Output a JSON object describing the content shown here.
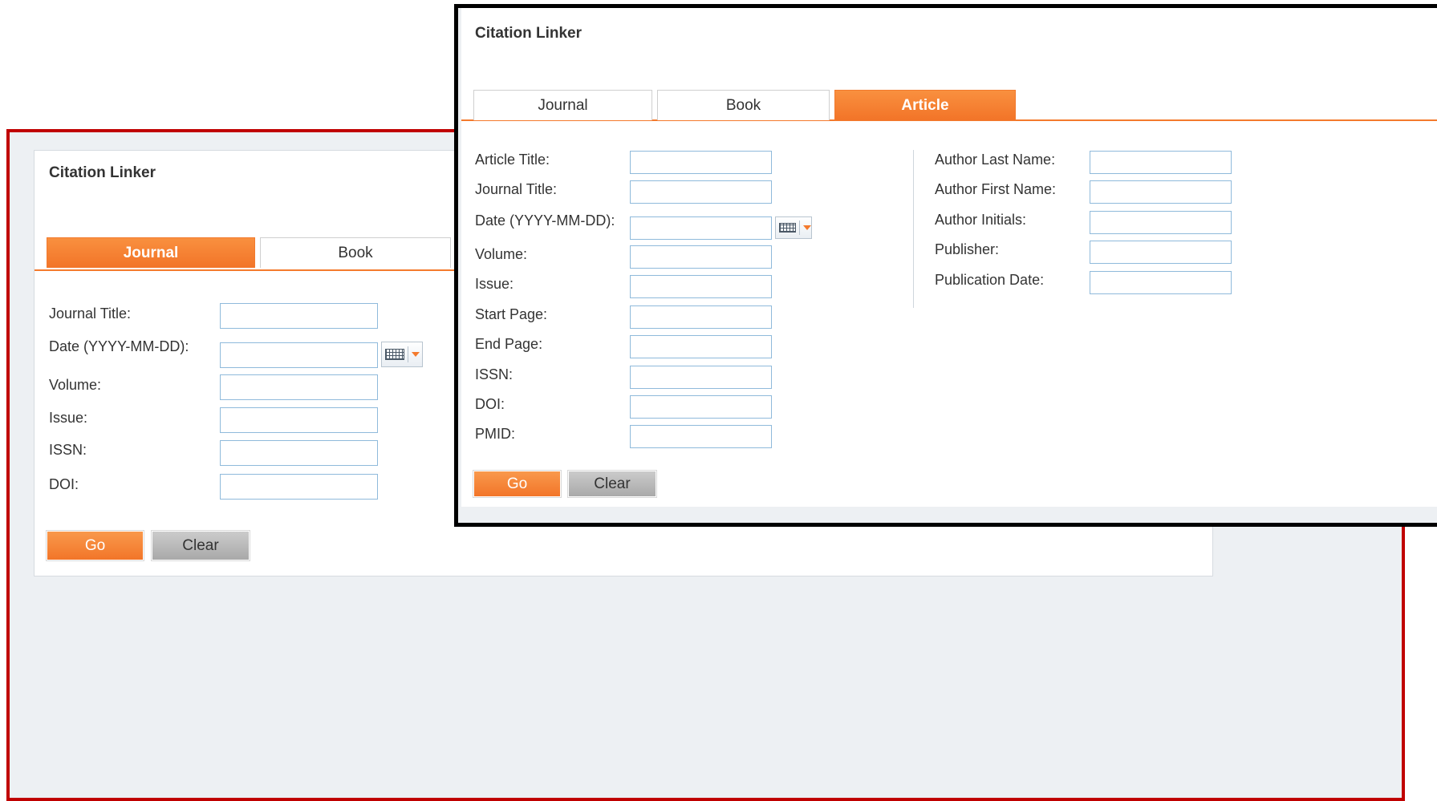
{
  "back": {
    "title": "Citation Linker",
    "tabs": [
      "Journal",
      "Book"
    ],
    "active_tab": "Journal",
    "fields": [
      {
        "label": "Journal Title:",
        "value": ""
      },
      {
        "label": "Date (YYYY-MM-DD):",
        "value": ""
      },
      {
        "label": "Volume:",
        "value": ""
      },
      {
        "label": "Issue:",
        "value": ""
      },
      {
        "label": "ISSN:",
        "value": ""
      },
      {
        "label": "DOI:",
        "value": ""
      }
    ],
    "go_label": "Go",
    "clear_label": "Clear"
  },
  "front": {
    "title": "Citation Linker",
    "tabs": [
      "Journal",
      "Book",
      "Article"
    ],
    "active_tab": "Article",
    "left_fields": [
      {
        "label": "Article Title:",
        "value": ""
      },
      {
        "label": "Journal Title:",
        "value": ""
      },
      {
        "label": "Date (YYYY-MM-DD):",
        "value": ""
      },
      {
        "label": "Volume:",
        "value": ""
      },
      {
        "label": "Issue:",
        "value": ""
      },
      {
        "label": "Start Page:",
        "value": ""
      },
      {
        "label": "End Page:",
        "value": ""
      },
      {
        "label": "ISSN:",
        "value": ""
      },
      {
        "label": "DOI:",
        "value": ""
      },
      {
        "label": "PMID:",
        "value": ""
      }
    ],
    "right_fields": [
      {
        "label": "Author Last Name:",
        "value": ""
      },
      {
        "label": "Author First Name:",
        "value": ""
      },
      {
        "label": "Author Initials:",
        "value": ""
      },
      {
        "label": "Publisher:",
        "value": ""
      },
      {
        "label": "Publication Date:",
        "value": ""
      }
    ],
    "go_label": "Go",
    "clear_label": "Clear"
  },
  "icons": {
    "calendar": "calendar-icon",
    "dropdown": "chevron-down-icon"
  },
  "colors": {
    "accent": "#f47a2d",
    "back_frame_border": "#c00000",
    "front_frame_border": "#000000",
    "input_border": "#8fbadb"
  }
}
